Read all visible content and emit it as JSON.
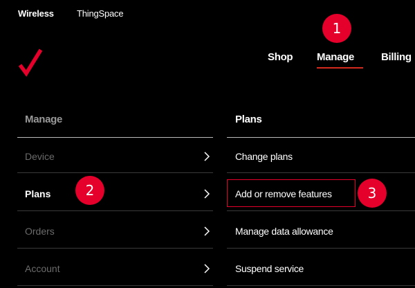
{
  "top_bar": {
    "wireless": "Wireless",
    "thingspace": "ThingSpace"
  },
  "main_nav": {
    "items": [
      "Shop",
      "Manage",
      "Billing"
    ],
    "active": "Manage"
  },
  "callouts": [
    "1",
    "2",
    "3"
  ],
  "left_column": {
    "header": "Manage",
    "items": [
      "Device",
      "Plans",
      "Orders",
      "Account"
    ],
    "active": "Plans"
  },
  "right_column": {
    "header": "Plans",
    "items": [
      "Change plans",
      "Add or remove features",
      "Manage data allowance",
      "Suspend service"
    ],
    "highlighted": "Add or remove features"
  },
  "colors": {
    "background": "#000000",
    "accent": "#e4002b",
    "inactive_text": "#6b6b6b"
  },
  "icons": [
    "verizon-check-logo",
    "chevron-right-icon"
  ]
}
